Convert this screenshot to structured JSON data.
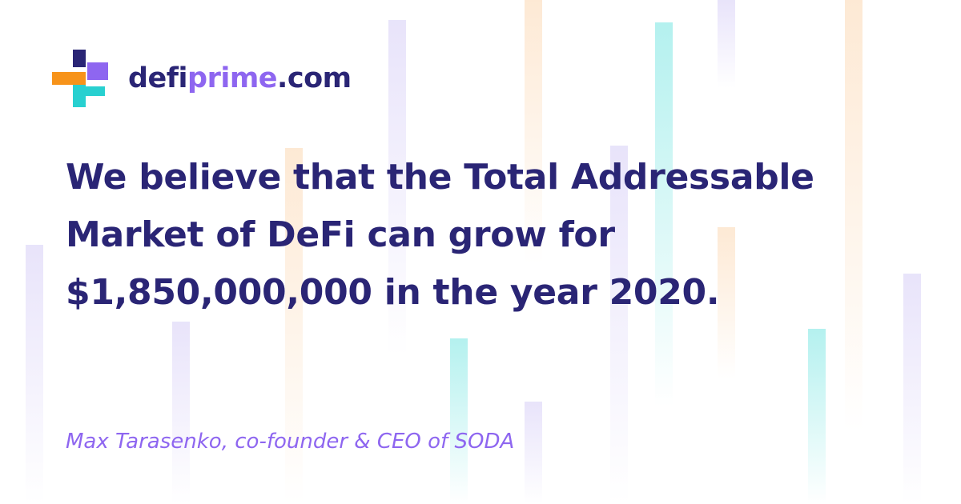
{
  "brand": {
    "name_part1": "defi",
    "name_part2": "prime",
    "name_part3": ".com",
    "logo_icon": "cross-plus-logo-icon",
    "colors": {
      "navy": "#2a2575",
      "purple": "#8e66f0",
      "orange": "#f7931a",
      "cyan": "#28d0d0"
    }
  },
  "quote": {
    "text": "We believe that the Total Addressable Market of DeFi can grow for $1,850,000,000 in the year 2020."
  },
  "author": {
    "text": "Max Tarasenko, co-founder & CEO of SODA"
  },
  "theme": {
    "background": "#ffffff",
    "text_color": "#2a2575",
    "accent": "#8e66f0"
  }
}
